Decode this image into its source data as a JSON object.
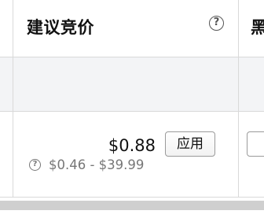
{
  "header": {
    "title": "建议竞价",
    "help_icon_glyph": "?",
    "next_column_title_partial": "黑"
  },
  "row": {
    "bid": "$0.88",
    "apply_label": "应用",
    "range_help_glyph": "?",
    "range": "$0.46 - $39.99"
  },
  "colors": {
    "border": "#d9d9d9",
    "empty_row_bg": "#f3f4f6",
    "secondary_text": "#777777"
  }
}
